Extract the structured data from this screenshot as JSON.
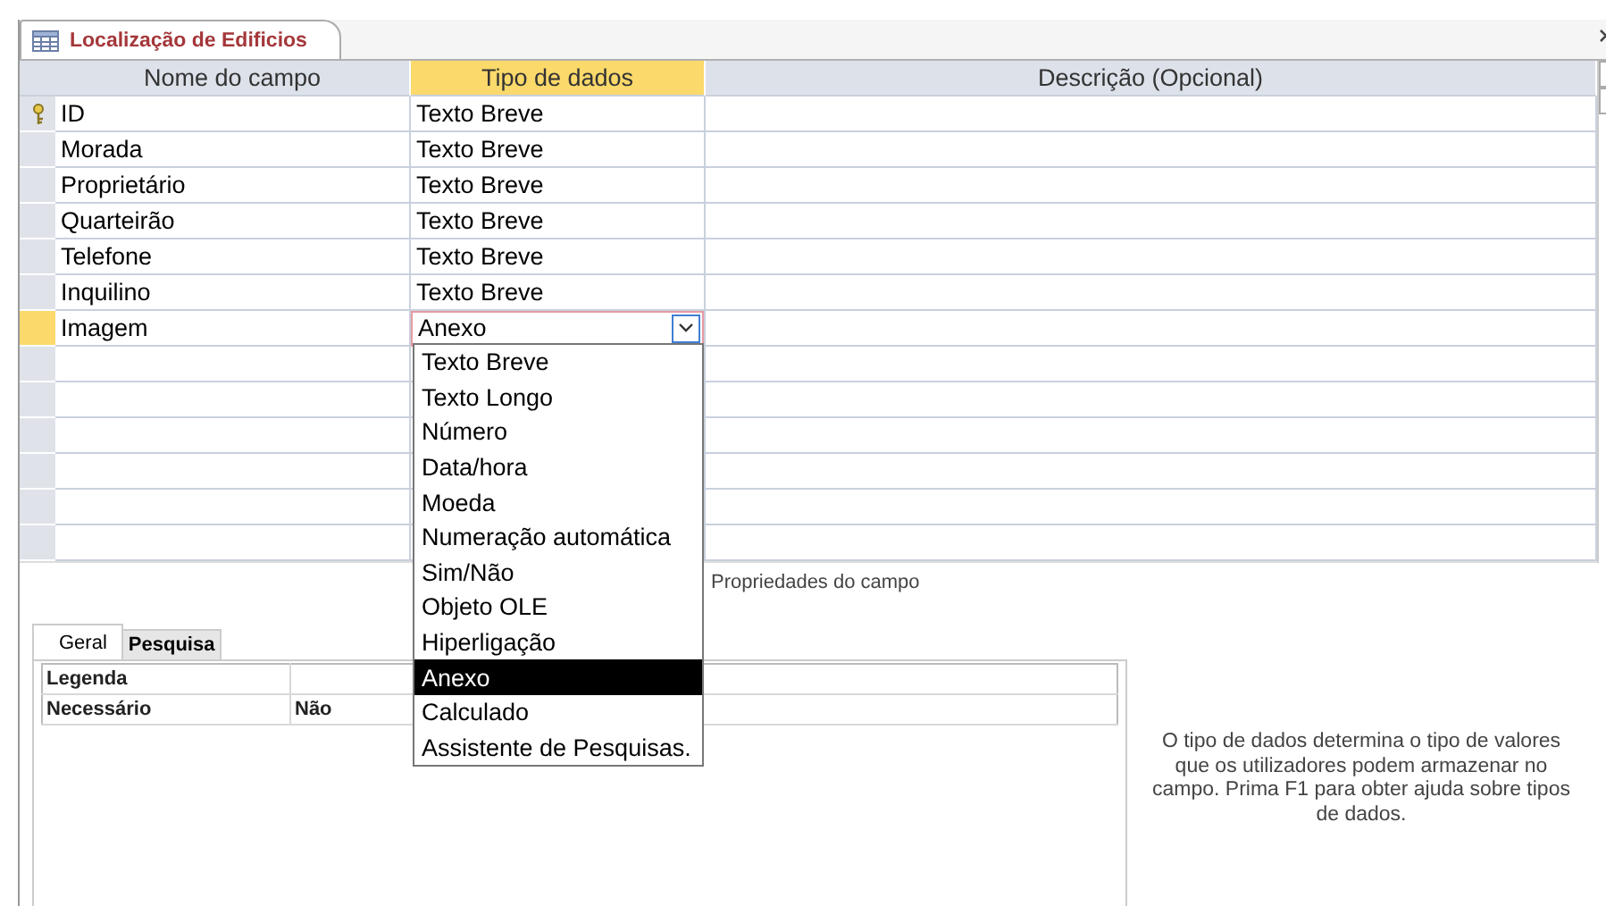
{
  "document_tab": {
    "title": "Localização de Edificios",
    "selected": true
  },
  "columns": [
    {
      "label": "Nome do campo",
      "active": false
    },
    {
      "label": "Tipo de dados",
      "active": true
    },
    {
      "label": "Descrição (Opcional)",
      "active": false
    }
  ],
  "fields": [
    {
      "name": "ID",
      "type": "Texto Breve",
      "primary_key": true,
      "selected": false
    },
    {
      "name": "Morada",
      "type": "Texto Breve",
      "primary_key": false,
      "selected": false
    },
    {
      "name": "Proprietário",
      "type": "Texto Breve",
      "primary_key": false,
      "selected": false
    },
    {
      "name": "Quarteirão",
      "type": "Texto Breve",
      "primary_key": false,
      "selected": false
    },
    {
      "name": "Telefone",
      "type": "Texto Breve",
      "primary_key": false,
      "selected": false
    },
    {
      "name": "Inquilino",
      "type": "Texto Breve",
      "primary_key": false,
      "selected": false
    },
    {
      "name": "Imagem",
      "type": "Anexo",
      "primary_key": false,
      "selected": true
    }
  ],
  "type_dropdown": {
    "options": [
      {
        "label": "Texto Breve",
        "selected": false
      },
      {
        "label": "Texto Longo",
        "selected": false
      },
      {
        "label": "Número",
        "selected": false
      },
      {
        "label": "Data/hora",
        "selected": false
      },
      {
        "label": "Moeda",
        "selected": false
      },
      {
        "label": "Numeração automática",
        "selected": false
      },
      {
        "label": "Sim/Não",
        "selected": false
      },
      {
        "label": "Objeto OLE",
        "selected": false
      },
      {
        "label": "Hiperligação",
        "selected": false
      },
      {
        "label": "Anexo",
        "selected": true
      },
      {
        "label": "Calculado",
        "selected": false
      },
      {
        "label": "Assistente de Pesquisas.",
        "selected": false
      }
    ]
  },
  "field_properties": {
    "caption": "Propriedades do campo",
    "tabs": [
      {
        "label": "Geral",
        "selected": true
      },
      {
        "label": "Pesquisa",
        "selected": false
      }
    ],
    "rows": [
      {
        "label": "Legenda"
      },
      {
        "label": "Necessário",
        "value": "Não"
      }
    ],
    "help_text": "O tipo de dados determina o tipo de valores que os utilizadores podem armazenar no campo. Prima F1 para obter ajuda sobre tipos de dados."
  }
}
